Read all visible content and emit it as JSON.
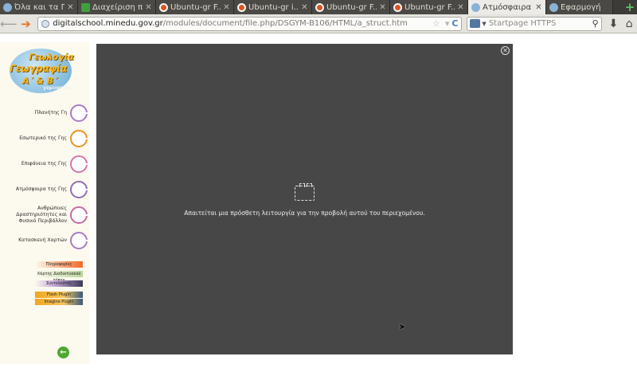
{
  "tabs": [
    {
      "title": "Όλα και τα Π...",
      "icon": "web-icon",
      "active": false
    },
    {
      "title": "Διαχείριση π...",
      "icon": "puzzle-icon",
      "active": false
    },
    {
      "title": "Ubuntu-gr F...",
      "icon": "ubuntu-icon",
      "active": false
    },
    {
      "title": "Ubuntu-gr i...",
      "icon": "ubuntu-icon",
      "active": false
    },
    {
      "title": "Ubuntu-gr F...",
      "icon": "ubuntu-icon",
      "active": false
    },
    {
      "title": "Ubuntu-gr F...",
      "icon": "ubuntu-icon",
      "active": false
    },
    {
      "title": "Ατμόσφαιρα",
      "icon": "web-icon",
      "active": true
    },
    {
      "title": "Εφαρμογή",
      "icon": "web-icon",
      "active": false
    }
  ],
  "nav": {
    "url_prefix": "",
    "url_domain": "digitalschool.minedu.gov.gr",
    "url_path": "/modules/document/file.php/DSGYM-B106/HTML/a_struct.htm",
    "search_placeholder": "Startpage HTTPS"
  },
  "logo": {
    "line1": "Γεωλογία",
    "line2": "Γεωγραφία",
    "line3": "Α΄ & Β΄",
    "line4": "γυμνασίου"
  },
  "menu": [
    {
      "label": "Πλανήτης Γη"
    },
    {
      "label": "Εσωτερικό της Γης"
    },
    {
      "label": "Επιφάνεια της Γης"
    },
    {
      "label": "Ατμόσφαιρα της Γης"
    },
    {
      "label": "Ανθρώπινες Δραστηριότητες και Φυσικό Περιβάλλον"
    },
    {
      "label": "Κατασκευή Χαρτών"
    }
  ],
  "legend": [
    {
      "label": "Πληροφορίες",
      "color": "#f06a2a"
    },
    {
      "label": "Χάρτης Διαδικτυακού τόπου",
      "color": "#b9d69a"
    },
    {
      "label": "Συντελεστές",
      "color": "#3a3a5a"
    },
    {
      "label": "Flash Plugin",
      "color": "#f1a61f"
    },
    {
      "label": "Imagine Plugin",
      "color": "#3a5a7a"
    }
  ],
  "content": {
    "message": "Απαιτείται μια πρόσθετη λειτουργία για την προβολή αυτού του περιεχομένου."
  },
  "colors": {
    "content_bg": "#474747",
    "tabbar_bg": "#3c3b37",
    "sidebar_bg": "#fcf9ee"
  }
}
